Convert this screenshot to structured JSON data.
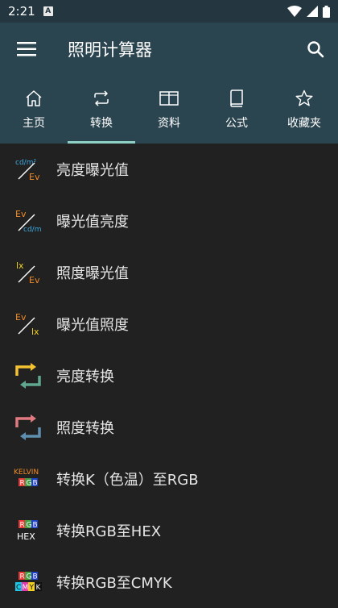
{
  "status_bar": {
    "time": "2:21",
    "notification_glyph": "A"
  },
  "app": {
    "title": "照明计算器"
  },
  "tabs": [
    {
      "label": "主页",
      "icon": "home-icon"
    },
    {
      "label": "转换",
      "icon": "repeat-icon"
    },
    {
      "label": "资料",
      "icon": "open-book-icon"
    },
    {
      "label": "公式",
      "icon": "book-icon"
    },
    {
      "label": "收藏夹",
      "icon": "star-icon"
    }
  ],
  "active_tab": "转换",
  "items": [
    {
      "label": "亮度曝光值",
      "icon": "cdm2-to-ev-icon",
      "icon_top": "cd/m²",
      "icon_bottom": "Ev"
    },
    {
      "label": "曝光值亮度",
      "icon": "ev-to-cdm2-icon",
      "icon_top": "Ev",
      "icon_bottom": "cd/m²"
    },
    {
      "label": "照度曝光值",
      "icon": "lx-to-ev-icon",
      "icon_top": "lx",
      "icon_bottom": "Ev"
    },
    {
      "label": "曝光值照度",
      "icon": "ev-to-lx-icon",
      "icon_top": "Ev",
      "icon_bottom": "lx"
    },
    {
      "label": "亮度转换",
      "icon": "luminance-convert-icon"
    },
    {
      "label": "照度转换",
      "icon": "illuminance-convert-icon"
    },
    {
      "label": "转换K（色温）至RGB",
      "icon": "kelvin-rgb-icon",
      "icon_top": "KELVIN",
      "icon_bottom": "RGB"
    },
    {
      "label": "转换RGB至HEX",
      "icon": "rgb-hex-icon",
      "icon_top": "RGB",
      "icon_bottom": "HEX"
    },
    {
      "label": "转换RGB至CMYK",
      "icon": "rgb-cmyk-icon",
      "icon_top": "RGB",
      "icon_bottom": "CMYK"
    }
  ],
  "colors": {
    "status_bar": "#243740",
    "toolbar": "#2b4550",
    "background": "#212121",
    "tab_indicator": "#8fd0c4"
  }
}
